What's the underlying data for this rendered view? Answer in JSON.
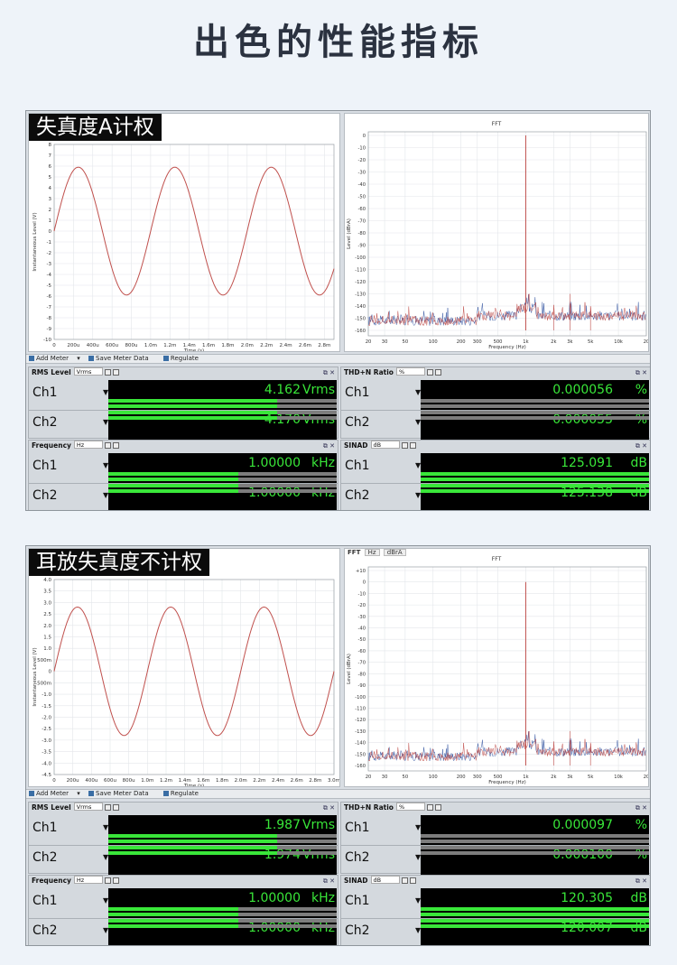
{
  "page": {
    "heading": "出色的性能指标"
  },
  "sections": [
    {
      "label": "失真度A计权",
      "time_plot": {
        "y_axis_label": "Instantaneous Level (V)",
        "y_ticks": [
          "8",
          "7",
          "6",
          "5",
          "4",
          "3",
          "2",
          "1",
          "0",
          "-1",
          "-2",
          "-3",
          "-4",
          "-5",
          "-6",
          "-7",
          "-8",
          "-9",
          "-10"
        ],
        "x_axis_label": "Time (s)",
        "x_ticks": [
          "0",
          "200u",
          "400u",
          "600u",
          "800u",
          "1.0m",
          "1.2m",
          "1.4m",
          "1.6m",
          "1.8m",
          "2.0m",
          "2.2m",
          "2.4m",
          "2.6m",
          "2.8m"
        ],
        "amplitude_v": 5.9,
        "ylim": [
          -10,
          8
        ]
      },
      "fft_plot": {
        "title": "FFT",
        "y_axis_label": "Level (dBrA)",
        "y_ticks": [
          "0",
          "-10",
          "-20",
          "-30",
          "-40",
          "-50",
          "-60",
          "-70",
          "-80",
          "-90",
          "-100",
          "-110",
          "-120",
          "-130",
          "-140",
          "-150",
          "-160"
        ],
        "x_axis_label": "Frequency (Hz)",
        "x_ticks": [
          "20",
          "30",
          "50",
          "100",
          "200",
          "300",
          "500",
          "1k",
          "2k",
          "3k",
          "5k",
          "10k",
          "20"
        ],
        "ylim": [
          -165,
          5
        ]
      },
      "toolbar": {
        "add_meter": "Add Meter",
        "save": "Save Meter Data",
        "regulate": "Regulate"
      },
      "meters": [
        {
          "title": "RMS Level",
          "unit_select": "Vrms",
          "channels": [
            {
              "name": "Ch1",
              "value": "4.162",
              "unit": "Vrms",
              "bar": 0.74
            },
            {
              "name": "Ch2",
              "value": "4.170",
              "unit": "Vrms",
              "bar": 0.74
            }
          ]
        },
        {
          "title": "THD+N Ratio",
          "unit_select": "%",
          "channels": [
            {
              "name": "Ch1",
              "value": "0.000056",
              "unit": "%",
              "bar": 0.0
            },
            {
              "name": "Ch2",
              "value": "0.000055",
              "unit": "%",
              "bar": 0.0
            }
          ]
        },
        {
          "title": "Frequency",
          "unit_select": "Hz",
          "channels": [
            {
              "name": "Ch1",
              "value": "1.00000",
              "unit": "kHz",
              "bar": 0.57
            },
            {
              "name": "Ch2",
              "value": "1.00000",
              "unit": "kHz",
              "bar": 0.57
            }
          ]
        },
        {
          "title": "SINAD",
          "unit_select": "dB",
          "channels": [
            {
              "name": "Ch1",
              "value": "125.091",
              "unit": "dB",
              "bar": 1.0
            },
            {
              "name": "Ch2",
              "value": "125.138",
              "unit": "dB",
              "bar": 1.0
            }
          ]
        }
      ]
    },
    {
      "label": "耳放失真度不计权",
      "time_plot": {
        "y_axis_label": "Instantaneous Level (V)",
        "y_ticks": [
          "4.0",
          "3.5",
          "3.0",
          "2.5",
          "2.0",
          "1.5",
          "1.0",
          "500m",
          "0",
          "-500m",
          "-1.0",
          "-1.5",
          "-2.0",
          "-2.5",
          "-3.0",
          "-3.5",
          "-4.0",
          "-4.5"
        ],
        "x_axis_label": "Time (s)",
        "x_ticks": [
          "0",
          "200u",
          "400u",
          "600u",
          "800u",
          "1.0m",
          "1.2m",
          "1.4m",
          "1.6m",
          "1.8m",
          "2.0m",
          "2.2m",
          "2.4m",
          "2.6m",
          "2.8m",
          "3.0m"
        ],
        "amplitude_v": 2.8,
        "ylim": [
          -4.5,
          4.0
        ]
      },
      "fft_plot": {
        "title": "FFT",
        "toolbar_text": "FFT",
        "toolbar_unit": "Hz",
        "toolbar_level": "dBrA",
        "y_axis_label": "Level (dBrA)",
        "y_ticks": [
          "+10",
          "0",
          "-10",
          "-20",
          "-30",
          "-40",
          "-50",
          "-60",
          "-70",
          "-80",
          "-90",
          "-100",
          "-110",
          "-120",
          "-130",
          "-140",
          "-150",
          "-160"
        ],
        "x_axis_label": "Frequency (Hz)",
        "x_ticks": [
          "20",
          "30",
          "50",
          "100",
          "200",
          "300",
          "500",
          "1k",
          "2k",
          "3k",
          "5k",
          "10k",
          "20"
        ],
        "ylim": [
          -160,
          10
        ]
      },
      "toolbar": {
        "add_meter": "Add Meter",
        "save": "Save Meter Data",
        "regulate": "Regulate"
      },
      "meters": [
        {
          "title": "RMS Level",
          "unit_select": "Vrms",
          "channels": [
            {
              "name": "Ch1",
              "value": "1.987",
              "unit": "Vrms",
              "bar": 0.74
            },
            {
              "name": "Ch2",
              "value": "1.974",
              "unit": "Vrms",
              "bar": 0.74
            }
          ]
        },
        {
          "title": "THD+N Ratio",
          "unit_select": "%",
          "channels": [
            {
              "name": "Ch1",
              "value": "0.000097",
              "unit": "%",
              "bar": 0.0
            },
            {
              "name": "Ch2",
              "value": "0.000100",
              "unit": "%",
              "bar": 0.0
            }
          ]
        },
        {
          "title": "Frequency",
          "unit_select": "Hz",
          "channels": [
            {
              "name": "Ch1",
              "value": "1.00000",
              "unit": "kHz",
              "bar": 0.57
            },
            {
              "name": "Ch2",
              "value": "1.00000",
              "unit": "kHz",
              "bar": 0.57
            }
          ]
        },
        {
          "title": "SINAD",
          "unit_select": "dB",
          "channels": [
            {
              "name": "Ch1",
              "value": "120.305",
              "unit": "dB",
              "bar": 1.0
            },
            {
              "name": "Ch2",
              "value": "120.007",
              "unit": "dB",
              "bar": 1.0
            }
          ]
        }
      ]
    }
  ],
  "colors": {
    "readout": "#39e639",
    "trace_ch1": "#c0504d",
    "trace_ch2": "#3b5ba5",
    "banner_bg": "#0b0b0b"
  }
}
